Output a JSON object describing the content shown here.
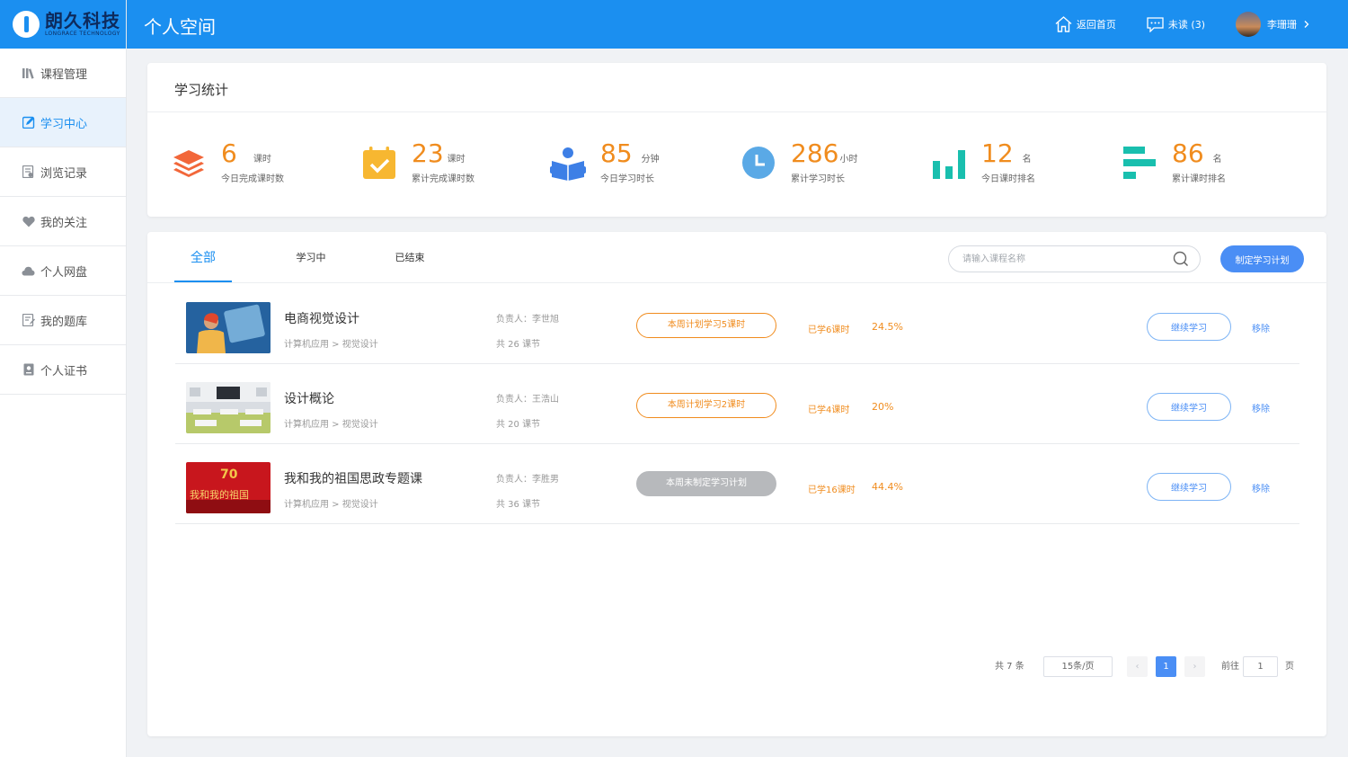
{
  "brand": {
    "name": "朗久科技",
    "sub": "LONGRACE TECHNOLOGY",
    "color": "#1b8ff0"
  },
  "sidebar": {
    "items": [
      {
        "label": "课程管理",
        "icon": "books-icon",
        "active": false
      },
      {
        "label": "学习中心",
        "icon": "edit-icon",
        "active": true
      },
      {
        "label": "浏览记录",
        "icon": "history-icon",
        "active": false
      },
      {
        "label": "我的关注",
        "icon": "heart-icon",
        "active": false
      },
      {
        "label": "个人网盘",
        "icon": "cloud-icon",
        "active": false
      },
      {
        "label": "我的题库",
        "icon": "question-bank-icon",
        "active": false
      },
      {
        "label": "个人证书",
        "icon": "certificate-icon",
        "active": false
      }
    ]
  },
  "header": {
    "title": "个人空间",
    "home_label": "返回首页",
    "messages_label": "未读 (3)",
    "user_name": "李珊珊"
  },
  "stats": {
    "title": "学习统计",
    "items": [
      {
        "num": "6",
        "unit": "课时",
        "label": "今日完成课时数",
        "icon": "layers-icon"
      },
      {
        "num": "23",
        "unit": "课时",
        "label": "累计完成课时数",
        "icon": "calendar-check-icon"
      },
      {
        "num": "85",
        "unit": "分钟",
        "label": "今日学习时长",
        "icon": "reader-icon"
      },
      {
        "num": "286",
        "unit": "小时",
        "label": "累计学习时长",
        "icon": "clock-icon"
      },
      {
        "num": "12",
        "unit": "名",
        "label": "今日课时排名",
        "icon": "bar-chart-icon"
      },
      {
        "num": "86",
        "unit": "名",
        "label": "累计课时排名",
        "icon": "horizontal-bars-icon"
      }
    ]
  },
  "tabs": [
    {
      "label": "全部",
      "active": true
    },
    {
      "label": "学习中",
      "active": false
    },
    {
      "label": "已结束",
      "active": false
    }
  ],
  "search": {
    "placeholder": "请输入课程名称"
  },
  "plan_button": "制定学习计划",
  "courses": [
    {
      "title": "电商视觉设计",
      "category": "计算机应用 > 视觉设计",
      "owner": "负责人：李世旭",
      "lessons": "共 26 课节",
      "plan": "本周计划学习5课时",
      "has_plan": true,
      "learned": "已学6课时",
      "percent": "24.5%",
      "continue": "继续学习",
      "remove": "移除"
    },
    {
      "title": "设计概论",
      "category": "计算机应用 > 视觉设计",
      "owner": "负责人：王浩山",
      "lessons": "共 20 课节",
      "plan": "本周计划学习2课时",
      "has_plan": true,
      "learned": "已学4课时",
      "percent": "20%",
      "continue": "继续学习",
      "remove": "移除"
    },
    {
      "title": "我和我的祖国思政专题课",
      "category": "计算机应用 > 视觉设计",
      "owner": "负责人：李胜男",
      "lessons": "共 36 课节",
      "plan": "本周未制定学习计划",
      "has_plan": false,
      "learned": "已学16课时",
      "percent": "44.4%",
      "continue": "继续学习",
      "remove": "移除",
      "thumb_text": "我和我的祖国"
    }
  ],
  "pagination": {
    "total": "共 7 条",
    "page_size": "15条/页",
    "prev": "‹",
    "current": "1",
    "next": "›",
    "goto_label": "前往",
    "goto_value": "1",
    "page_suffix": "页"
  },
  "colors": {
    "accent": "#1b8ff0",
    "orange": "#f08c1e",
    "teal": "#19bfae",
    "button_blue": "#4a8ef5"
  }
}
